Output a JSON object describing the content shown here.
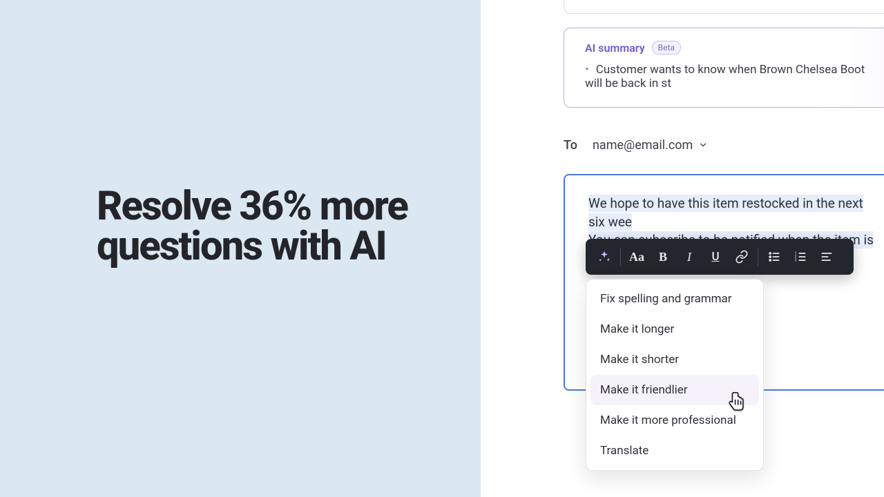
{
  "left": {
    "headline": "Resolve 36% more questions with AI"
  },
  "summary": {
    "title": "AI summary",
    "badge": "Beta",
    "items": [
      "Customer wants to know when Brown Chelsea Boot will be back in st"
    ]
  },
  "compose": {
    "to_label": "To",
    "to_email": "name@email.com",
    "body_line1": "We hope to have this item restocked in the next six wee",
    "body_line2": "You can subscribe to be notified when the item is availa"
  },
  "toolbar": {
    "ai_icon": "sparkle-icon",
    "text_style": "Aa",
    "bold": "B",
    "italic": "I",
    "underline": "U"
  },
  "menu": {
    "items": [
      "Fix spelling and grammar",
      "Make it longer",
      "Make it shorter",
      "Make it friendlier",
      "Make it more professional",
      "Translate"
    ],
    "hovered_index": 3
  }
}
